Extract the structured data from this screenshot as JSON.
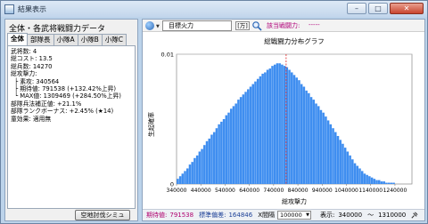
{
  "window": {
    "title": "結果表示",
    "buttons": {
      "minimize": "–",
      "maximize": "□",
      "close": "✕"
    }
  },
  "left": {
    "title": "全体・各武将戦闘力データ",
    "tabs": [
      "全体",
      "部隊長",
      "小隊A",
      "小隊B",
      "小隊C"
    ],
    "active_tab": 0,
    "stats": [
      {
        "text": "武将数: 4",
        "indent": false
      },
      {
        "text": "総コスト: 13.5",
        "indent": false
      },
      {
        "text": "総兵数: 14270",
        "indent": false
      },
      {
        "text": "総攻撃力:",
        "indent": false
      },
      {
        "text": "├ 素攻: 340564",
        "indent": true
      },
      {
        "text": "├ 期待値: 791538 (+132.42%上昇)",
        "indent": true
      },
      {
        "text": "└ MAX値: 1309469 (+284.50%上昇)",
        "indent": true
      },
      {
        "text": "部隊兵法補正値: +21.1%",
        "indent": false
      },
      {
        "text": "部隊ランクボーナス: +2.45% (★14)",
        "indent": false
      },
      {
        "text": "童効果: 適用無",
        "indent": false
      }
    ],
    "sim_button": "空地討伐シミュ"
  },
  "toolbar": {
    "icon": "globe-icon",
    "field_value": "目標火力",
    "unit": "[万]",
    "search_icon": "search-icon",
    "target_label": "該当戦闘力:",
    "target_value": "-----"
  },
  "chart_data": {
    "type": "bar",
    "title": "総戦闘力分布グラフ",
    "xlabel": "総攻撃力",
    "ylabel": "生起確率",
    "xlim": [
      340000,
      1310000
    ],
    "ylim": [
      0,
      0.01
    ],
    "y_ticks": [
      "0",
      "0.01"
    ],
    "x_ticks": [
      {
        "value": 340000,
        "label": "340000"
      },
      {
        "value": 440000,
        "label": "440000"
      },
      {
        "value": 540000,
        "label": "540000"
      },
      {
        "value": 640000,
        "label": "640000"
      },
      {
        "value": 740000,
        "label": "740000"
      },
      {
        "value": 840000,
        "label": "840000"
      },
      {
        "value": 940000,
        "label": "940000"
      },
      {
        "value": 1040000,
        "label": "1040000"
      },
      {
        "value": 1140000,
        "label": "1140000"
      },
      {
        "value": 1240000,
        "label": "1240000"
      }
    ],
    "bin_width": 10000,
    "values": [
      0.0004,
      0.0006,
      0.0008,
      0.001,
      0.0012,
      0.0015,
      0.0017,
      0.002,
      0.0022,
      0.0025,
      0.0027,
      0.003,
      0.0033,
      0.0035,
      0.0038,
      0.004,
      0.0043,
      0.0046,
      0.0048,
      0.005,
      0.0053,
      0.0055,
      0.0058,
      0.006,
      0.0062,
      0.0065,
      0.0067,
      0.0069,
      0.0071,
      0.0073,
      0.0075,
      0.0077,
      0.0079,
      0.0081,
      0.0083,
      0.0085,
      0.0086,
      0.0088,
      0.0089,
      0.0091,
      0.0092,
      0.0093,
      0.0093,
      0.0092,
      0.0091,
      0.009,
      0.0088,
      0.0086,
      0.0084,
      0.0082,
      0.008,
      0.0077,
      0.0075,
      0.0072,
      0.007,
      0.0067,
      0.0065,
      0.0062,
      0.006,
      0.0057,
      0.0055,
      0.0052,
      0.0049,
      0.0046,
      0.0043,
      0.004,
      0.0037,
      0.0034,
      0.0031,
      0.0028,
      0.0025,
      0.0022,
      0.0019,
      0.0016,
      0.0014,
      0.0012,
      0.001,
      0.0008,
      0.0007,
      0.0006,
      0.0005,
      0.0004,
      0.0003,
      0.0003,
      0.0002,
      0.0002,
      0.0001,
      0.0001,
      0.0001,
      0.0001,
      0.0,
      0.0,
      0.0,
      0.0,
      0.0,
      0.0,
      0.0
    ],
    "expected_marker": 791538,
    "colors": {
      "bar": "#3f8ef0",
      "marker": "#e02020",
      "grid": "#cccccc"
    }
  },
  "status": {
    "expected_label": "期待値:",
    "expected_value": "791538",
    "stddev_label": "標準偏差:",
    "stddev_value": "164846",
    "interval_label": "X間隔",
    "interval_value": "100000",
    "display_label": "表示:",
    "display_from": "340000",
    "tilde": "〜",
    "display_to": "1310000",
    "pin_icon": "pin-icon"
  }
}
